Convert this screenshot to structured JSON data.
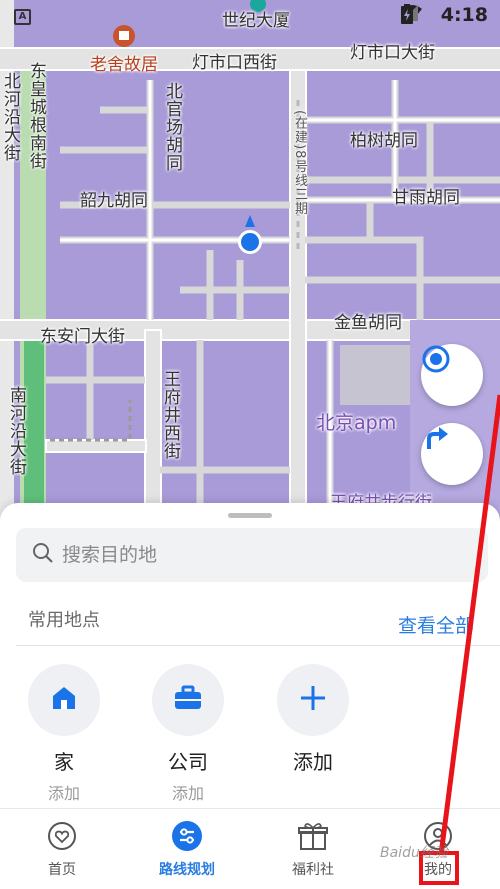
{
  "status_bar": {
    "notification_icon": "A",
    "time": "4:18",
    "icons": [
      "location-icon",
      "wifi-icon",
      "signal-icon",
      "battery-icon"
    ]
  },
  "map": {
    "labels": {
      "shiji_building": "世纪大厦",
      "laoshe": "老舍故居",
      "dengshikou_west": "灯市口西街",
      "dengshikou_street": "灯市口大街",
      "dongsheng": "东皇城根南街",
      "beihe": "北河沿大街",
      "beiguanchang": "北官场胡同",
      "line8": "(在建)8号线三期",
      "baishu": "柏树胡同",
      "shaojiu": "韶九胡同",
      "ganyu": "甘雨胡同",
      "donganmen": "东安门大街",
      "jinyu": "金鱼胡同",
      "nanhe": "南河沿大街",
      "wangfujing_west": "王府井西街",
      "apm": "北京apm",
      "wangfujing_walk": "王府井步行街"
    }
  },
  "map_buttons": {
    "locate": "locate-icon",
    "route": "turn-right-icon"
  },
  "sheet": {
    "search_placeholder": "搜索目的地",
    "favorites_title": "常用地点",
    "view_all": "查看全部",
    "places": [
      {
        "name": "家",
        "sub": "添加",
        "icon": "home-icon"
      },
      {
        "name": "公司",
        "sub": "添加",
        "icon": "briefcase-icon"
      },
      {
        "name": "添加",
        "sub": "",
        "icon": "plus-icon"
      }
    ]
  },
  "tabs": [
    {
      "label": "首页",
      "icon": "heart-icon",
      "active": false
    },
    {
      "label": "路线规划",
      "icon": "route-icon",
      "active": true
    },
    {
      "label": "福利社",
      "icon": "gift-icon",
      "active": false
    },
    {
      "label": "我的",
      "icon": "profile-icon",
      "active": false
    }
  ],
  "colors": {
    "accent": "#2a7de1",
    "map_purple": "#a99bd8",
    "annotation_red": "#e8141a"
  },
  "watermark": "Baidu经验"
}
